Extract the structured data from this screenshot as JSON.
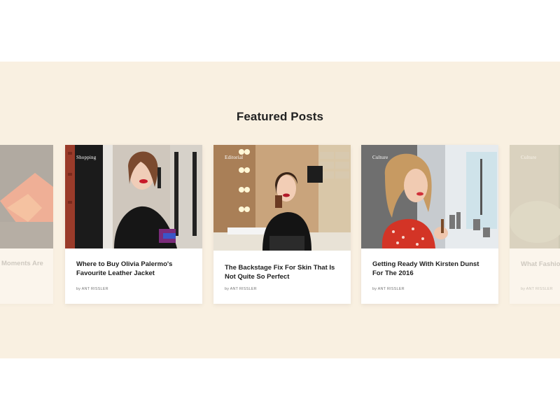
{
  "section": {
    "title": "Featured Posts"
  },
  "cards": [
    {
      "title": "Moments Are",
      "tag": "",
      "author": ""
    },
    {
      "tag": "Shopping",
      "title": "Where to Buy Olivia Palermo's Favourite Leather Jacket",
      "author": "by ANT RISSLER"
    },
    {
      "tag": "Editorial",
      "title": "The Backstage Fix For Skin That Is Not Quite So Perfect",
      "author": "by ANT RISSLER"
    },
    {
      "tag": "Culture",
      "title": "Getting Ready With Kirsten Dunst For The 2016",
      "author": "by ANT RISSLER"
    },
    {
      "tag": "Culture",
      "title": "What Fashion Aldi—No, Ser",
      "author": "by ANT RISSLER"
    }
  ],
  "colors": {
    "band_background": "#f9f0e1",
    "card_background": "#ffffff",
    "title_text": "#222222"
  }
}
